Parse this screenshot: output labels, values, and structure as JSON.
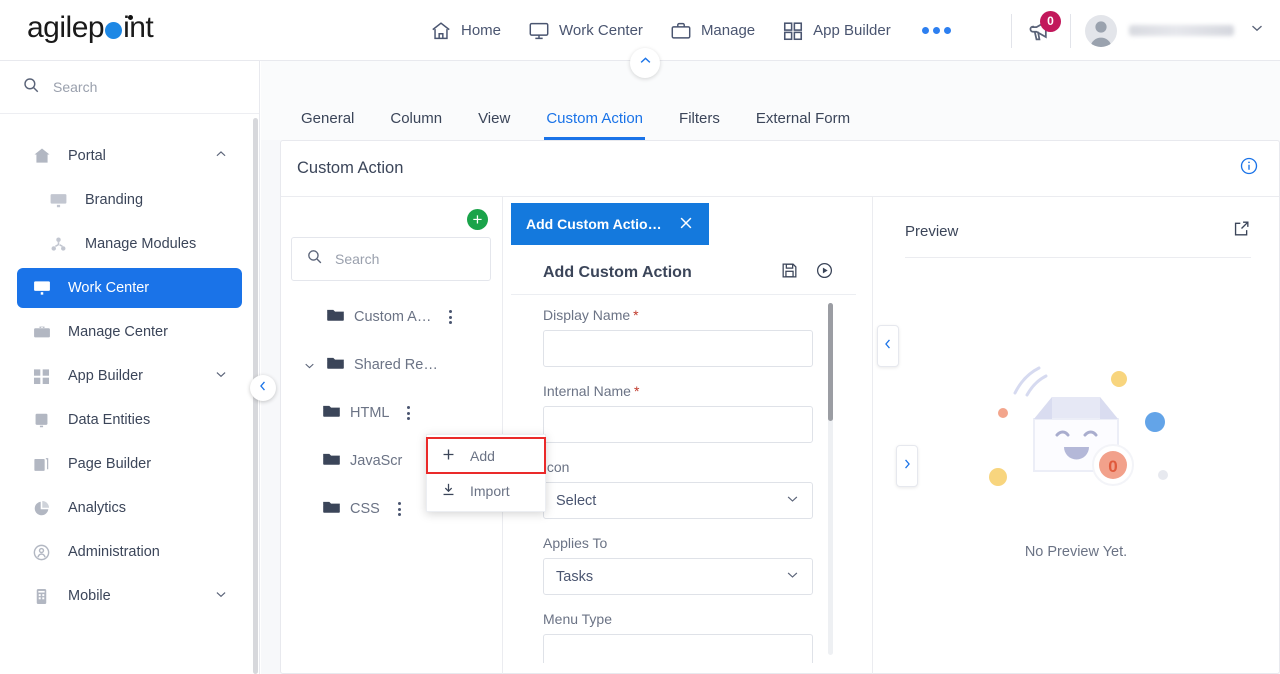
{
  "brand": {
    "name": "agilepoint",
    "accent": "#1e88e5"
  },
  "header": {
    "nav": [
      {
        "label": "Home",
        "icon": "home-icon"
      },
      {
        "label": "Work Center",
        "icon": "monitor-icon"
      },
      {
        "label": "Manage",
        "icon": "briefcase-icon"
      },
      {
        "label": "App Builder",
        "icon": "grid-icon"
      }
    ],
    "more_label": "•••",
    "announcement": {
      "icon": "megaphone-icon",
      "count": "0",
      "badge_color": "#c2185b"
    },
    "user": {
      "name_masked": "",
      "avatar": "avatar-icon",
      "caret": "chevron-down-icon"
    }
  },
  "sidebar": {
    "search_placeholder": "Search",
    "items": [
      {
        "label": "Portal",
        "icon": "home-icon",
        "expand": "chevron-up-icon",
        "active": false,
        "sub": false
      },
      {
        "label": "Branding",
        "icon": "branding-icon",
        "expand": "",
        "active": false,
        "sub": true
      },
      {
        "label": "Manage Modules",
        "icon": "modules-icon",
        "expand": "",
        "active": false,
        "sub": true
      },
      {
        "label": "Work Center",
        "icon": "workcenter-icon",
        "expand": "",
        "active": true,
        "sub": false
      },
      {
        "label": "Manage Center",
        "icon": "briefcase-icon",
        "expand": "",
        "active": false,
        "sub": false
      },
      {
        "label": "App Builder",
        "icon": "grid-icon",
        "expand": "chevron-down-icon",
        "active": false,
        "sub": false
      },
      {
        "label": "Data Entities",
        "icon": "database-icon",
        "expand": "",
        "active": false,
        "sub": false
      },
      {
        "label": "Page Builder",
        "icon": "pages-icon",
        "expand": "",
        "active": false,
        "sub": false
      },
      {
        "label": "Analytics",
        "icon": "piechart-icon",
        "expand": "",
        "active": false,
        "sub": false
      },
      {
        "label": "Administration",
        "icon": "user-shield-icon",
        "expand": "",
        "active": false,
        "sub": false
      },
      {
        "label": "Mobile",
        "icon": "mobile-icon",
        "expand": "chevron-down-icon",
        "active": false,
        "sub": false
      }
    ],
    "collapse_icon": "chevron-left-icon"
  },
  "tabs": [
    {
      "label": "General",
      "active": false
    },
    {
      "label": "Column",
      "active": false
    },
    {
      "label": "View",
      "active": false
    },
    {
      "label": "Custom Action",
      "active": true
    },
    {
      "label": "Filters",
      "active": false
    },
    {
      "label": "External Form",
      "active": false
    }
  ],
  "panel": {
    "title": "Custom Action",
    "info_icon": "info-icon",
    "collapse_top_icon": "chevron-up-icon"
  },
  "tree": {
    "add_button": "+",
    "search_placeholder": "Search",
    "rows": [
      {
        "label": "Custom A…",
        "depth": 0,
        "expander": "",
        "kebab": true
      },
      {
        "label": "Shared Re…",
        "depth": 0,
        "expander": "chevron-down-icon",
        "kebab": false
      },
      {
        "label": "HTML",
        "depth": 1,
        "expander": "",
        "kebab": true
      },
      {
        "label": "JavaScr",
        "depth": 1,
        "expander": "",
        "kebab": false
      },
      {
        "label": "CSS",
        "depth": 1,
        "expander": "",
        "kebab": true
      }
    ],
    "context_menu": [
      {
        "label": "Add",
        "icon": "plus-icon",
        "highlighted": true
      },
      {
        "label": "Import",
        "icon": "download-icon",
        "highlighted": false
      }
    ],
    "highlight_color": "#ea2a2a"
  },
  "dialog": {
    "tab_title": "Add Custom Actio…",
    "close_icon": "close-icon",
    "title": "Add Custom Action",
    "save_icon": "save-icon",
    "run_icon": "play-circle-icon",
    "fields": [
      {
        "label": "Display Name",
        "required": true,
        "type": "text",
        "value": "",
        "icon": ""
      },
      {
        "label": "Internal Name",
        "required": true,
        "type": "text",
        "value": "",
        "icon": ""
      },
      {
        "label": "Icon",
        "required": false,
        "type": "select",
        "value": "Select",
        "icon": "chevron-down-icon"
      },
      {
        "label": "Applies To",
        "required": false,
        "type": "select",
        "value": "Tasks",
        "icon": "chevron-down-icon"
      },
      {
        "label": "Menu Type",
        "required": false,
        "type": "text",
        "value": "",
        "icon": ""
      }
    ]
  },
  "handles": {
    "left_handle_icon": "chevron-left-icon",
    "right_handle_icon": "chevron-right-icon"
  },
  "preview": {
    "title": "Preview",
    "popout_icon": "external-link-icon",
    "empty_text": "No Preview Yet.",
    "empty_badge": "0",
    "illustration": "empty-box-icon"
  }
}
